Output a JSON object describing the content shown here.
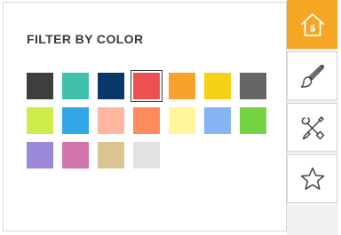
{
  "filter_panel": {
    "title": "FILTER BY COLOR",
    "swatches": [
      {
        "name": "dark-gray",
        "color": "#3e3e3e",
        "selected": false
      },
      {
        "name": "teal",
        "color": "#40c0a8",
        "selected": false
      },
      {
        "name": "navy",
        "color": "#0a3768",
        "selected": false
      },
      {
        "name": "red",
        "color": "#ed5050",
        "selected": true
      },
      {
        "name": "orange",
        "color": "#f6a22d",
        "selected": false
      },
      {
        "name": "yellow",
        "color": "#f4d116",
        "selected": false
      },
      {
        "name": "gray",
        "color": "#666666",
        "selected": false
      },
      {
        "name": "lime",
        "color": "#cdec4a",
        "selected": false
      },
      {
        "name": "sky-blue",
        "color": "#31a8e6",
        "selected": false
      },
      {
        "name": "peach",
        "color": "#ffb6a0",
        "selected": false
      },
      {
        "name": "coral",
        "color": "#ff8a5c",
        "selected": false
      },
      {
        "name": "pale-yellow",
        "color": "#fff59a",
        "selected": false
      },
      {
        "name": "light-blue",
        "color": "#86b4f4",
        "selected": false
      },
      {
        "name": "green",
        "color": "#76d344",
        "selected": false
      },
      {
        "name": "lavender",
        "color": "#9b88d8",
        "selected": false
      },
      {
        "name": "pink",
        "color": "#d174aa",
        "selected": false
      },
      {
        "name": "tan",
        "color": "#d8c592",
        "selected": false
      },
      {
        "name": "light-gray",
        "color": "#e2e2e2",
        "selected": false
      }
    ]
  },
  "side_rail": {
    "buttons": [
      {
        "icon": "house-dollar-icon",
        "active": true
      },
      {
        "icon": "paintbrush-icon",
        "active": false
      },
      {
        "icon": "tools-icon",
        "active": false
      },
      {
        "icon": "star-icon",
        "active": false
      }
    ]
  },
  "colors": {
    "accent": "#f5a623",
    "border": "#d6d6d6",
    "title_text": "#3a3a3a",
    "icon_stroke": "#444444"
  }
}
